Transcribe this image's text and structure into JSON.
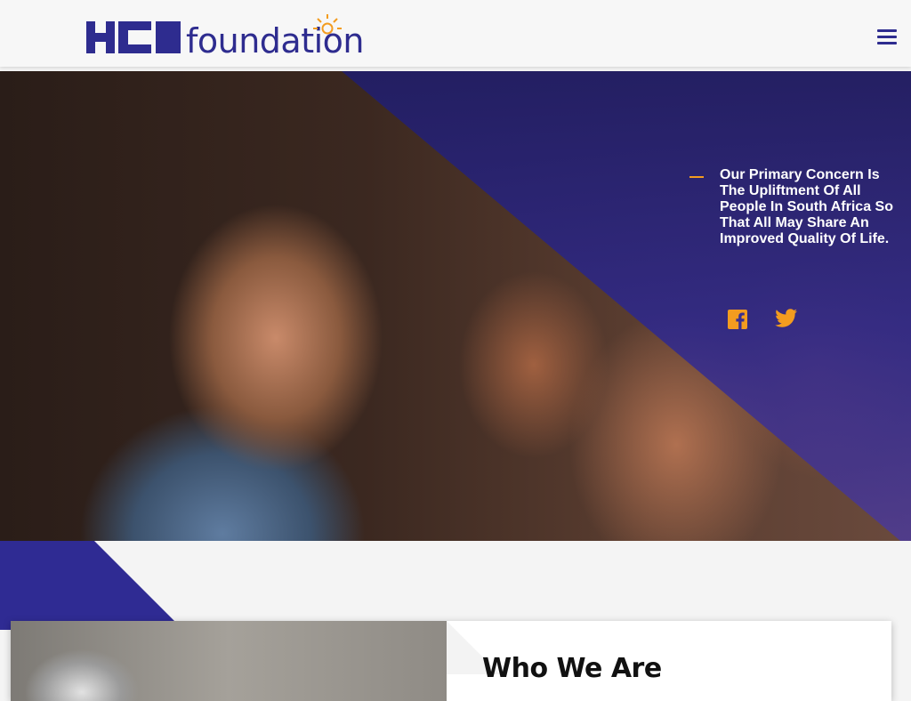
{
  "header": {
    "logo": {
      "brand_mark": "HCI",
      "wordmark": "foundation"
    },
    "menu_icon": "hamburger-menu-icon"
  },
  "hero": {
    "tagline": "Our Primary Concern Is The Upliftment Of All People In South Africa So That All May Share An Improved Quality Of Life.",
    "social": [
      {
        "name": "facebook",
        "icon": "facebook-icon"
      },
      {
        "name": "twitter",
        "icon": "twitter-icon"
      }
    ]
  },
  "about": {
    "title": "Who We Are"
  },
  "colors": {
    "brand_blue": "#2e2c8f",
    "accent_orange": "#f39c1f",
    "header_bg": "#f7f7f7",
    "page_bg": "#f4f4f4"
  }
}
